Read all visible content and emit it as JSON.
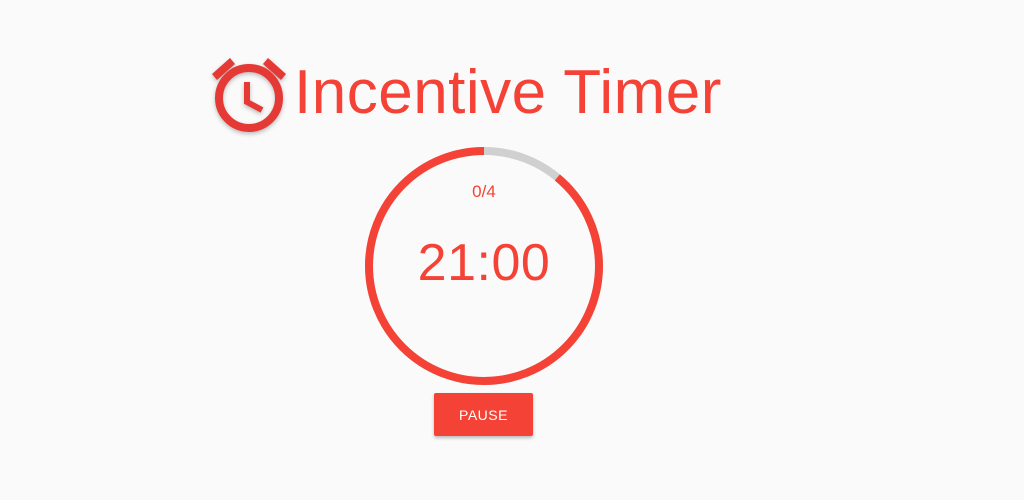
{
  "header": {
    "title": "Incentive Timer",
    "logo_icon": "alarm-clock-icon"
  },
  "timer": {
    "session_count": "0/4",
    "time_remaining": "21:00",
    "progress_remaining_fraction": 0.89
  },
  "controls": {
    "pause_label": "PAUSE"
  },
  "colors": {
    "accent": "#f44336",
    "track": "#d0d0d0",
    "background": "#fafafa"
  }
}
